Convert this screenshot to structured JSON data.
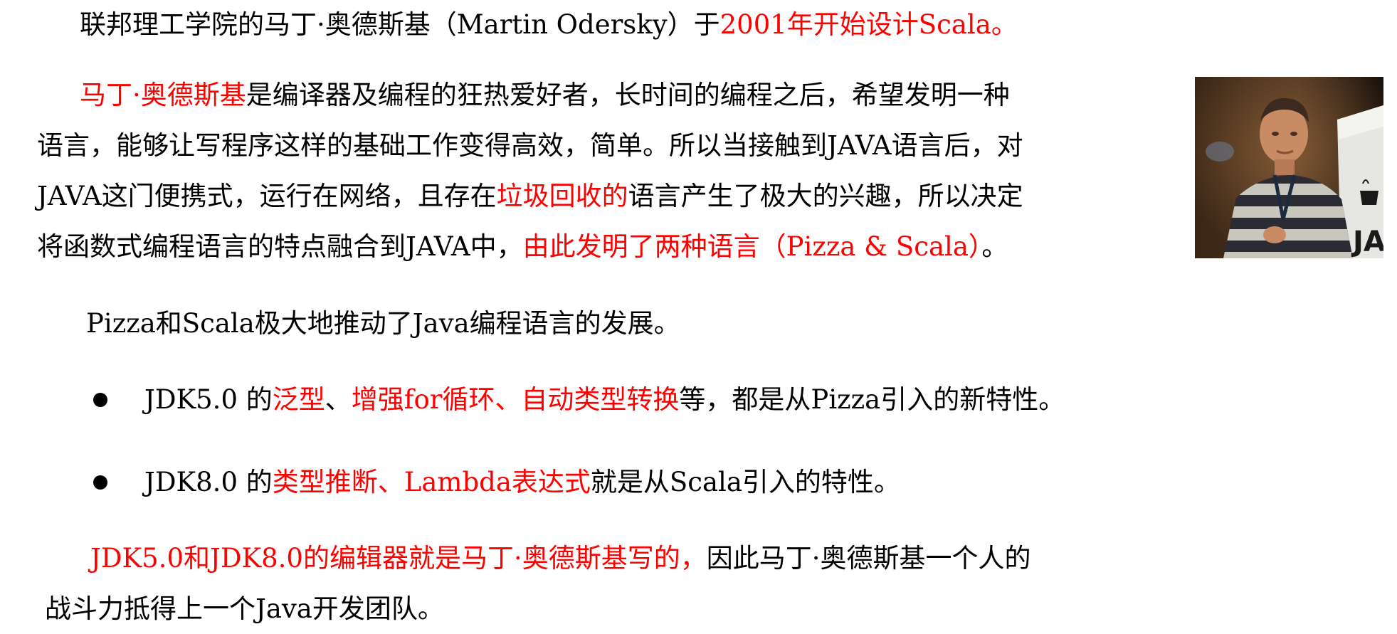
{
  "paragraph1": {
    "line1": {
      "a": "联邦理工学院的马丁·奥德斯基（Martin Odersky）于",
      "b": "2001年开始设计Scala。"
    }
  },
  "paragraph2": {
    "line1": {
      "a": "马丁·奥德斯基",
      "b": "是编译器及编程的狂热爱好者，长时间的编程之后，希望发明一种"
    },
    "line2": "语言，能够让写程序这样的基础工作变得高效，简单。所以当接触到JAVA语言后，对",
    "line3": {
      "a": "JAVA这门便携式，运行在网络，且存在",
      "b": "垃圾回收的",
      "c": "语言产生了极大的兴趣，所以决定"
    },
    "line4": {
      "a": "将函数式编程语言的特点融合到JAVA中，",
      "b": "由此发明了两种语言（Pizza & Scala）",
      "c": "。"
    }
  },
  "paragraph3": "Pizza和Scala极大地推动了Java编程语言的发展。",
  "bullets": [
    {
      "a": "JDK5.0  的",
      "b": "泛型",
      "c": "、",
      "d": "增强for循环、自动类型转换",
      "e": "等，都是从Pizza引入的新特性。"
    },
    {
      "a": "JDK8.0  的",
      "b": "类型推断、Lambda表达式",
      "c": "就是从Scala引入的特性。"
    }
  ],
  "paragraph4": {
    "line1": {
      "a": "JDK5.0和JDK8.0的编辑器就是马丁·奥德斯基写的，",
      "b": "因此马丁·奥德斯基一个人的"
    },
    "line2": "战斗力抵得上一个Java开发团队。"
  },
  "photo": {
    "sign_text": "JAVA"
  },
  "colors": {
    "text": "#000000",
    "highlight": "#ff0000"
  }
}
